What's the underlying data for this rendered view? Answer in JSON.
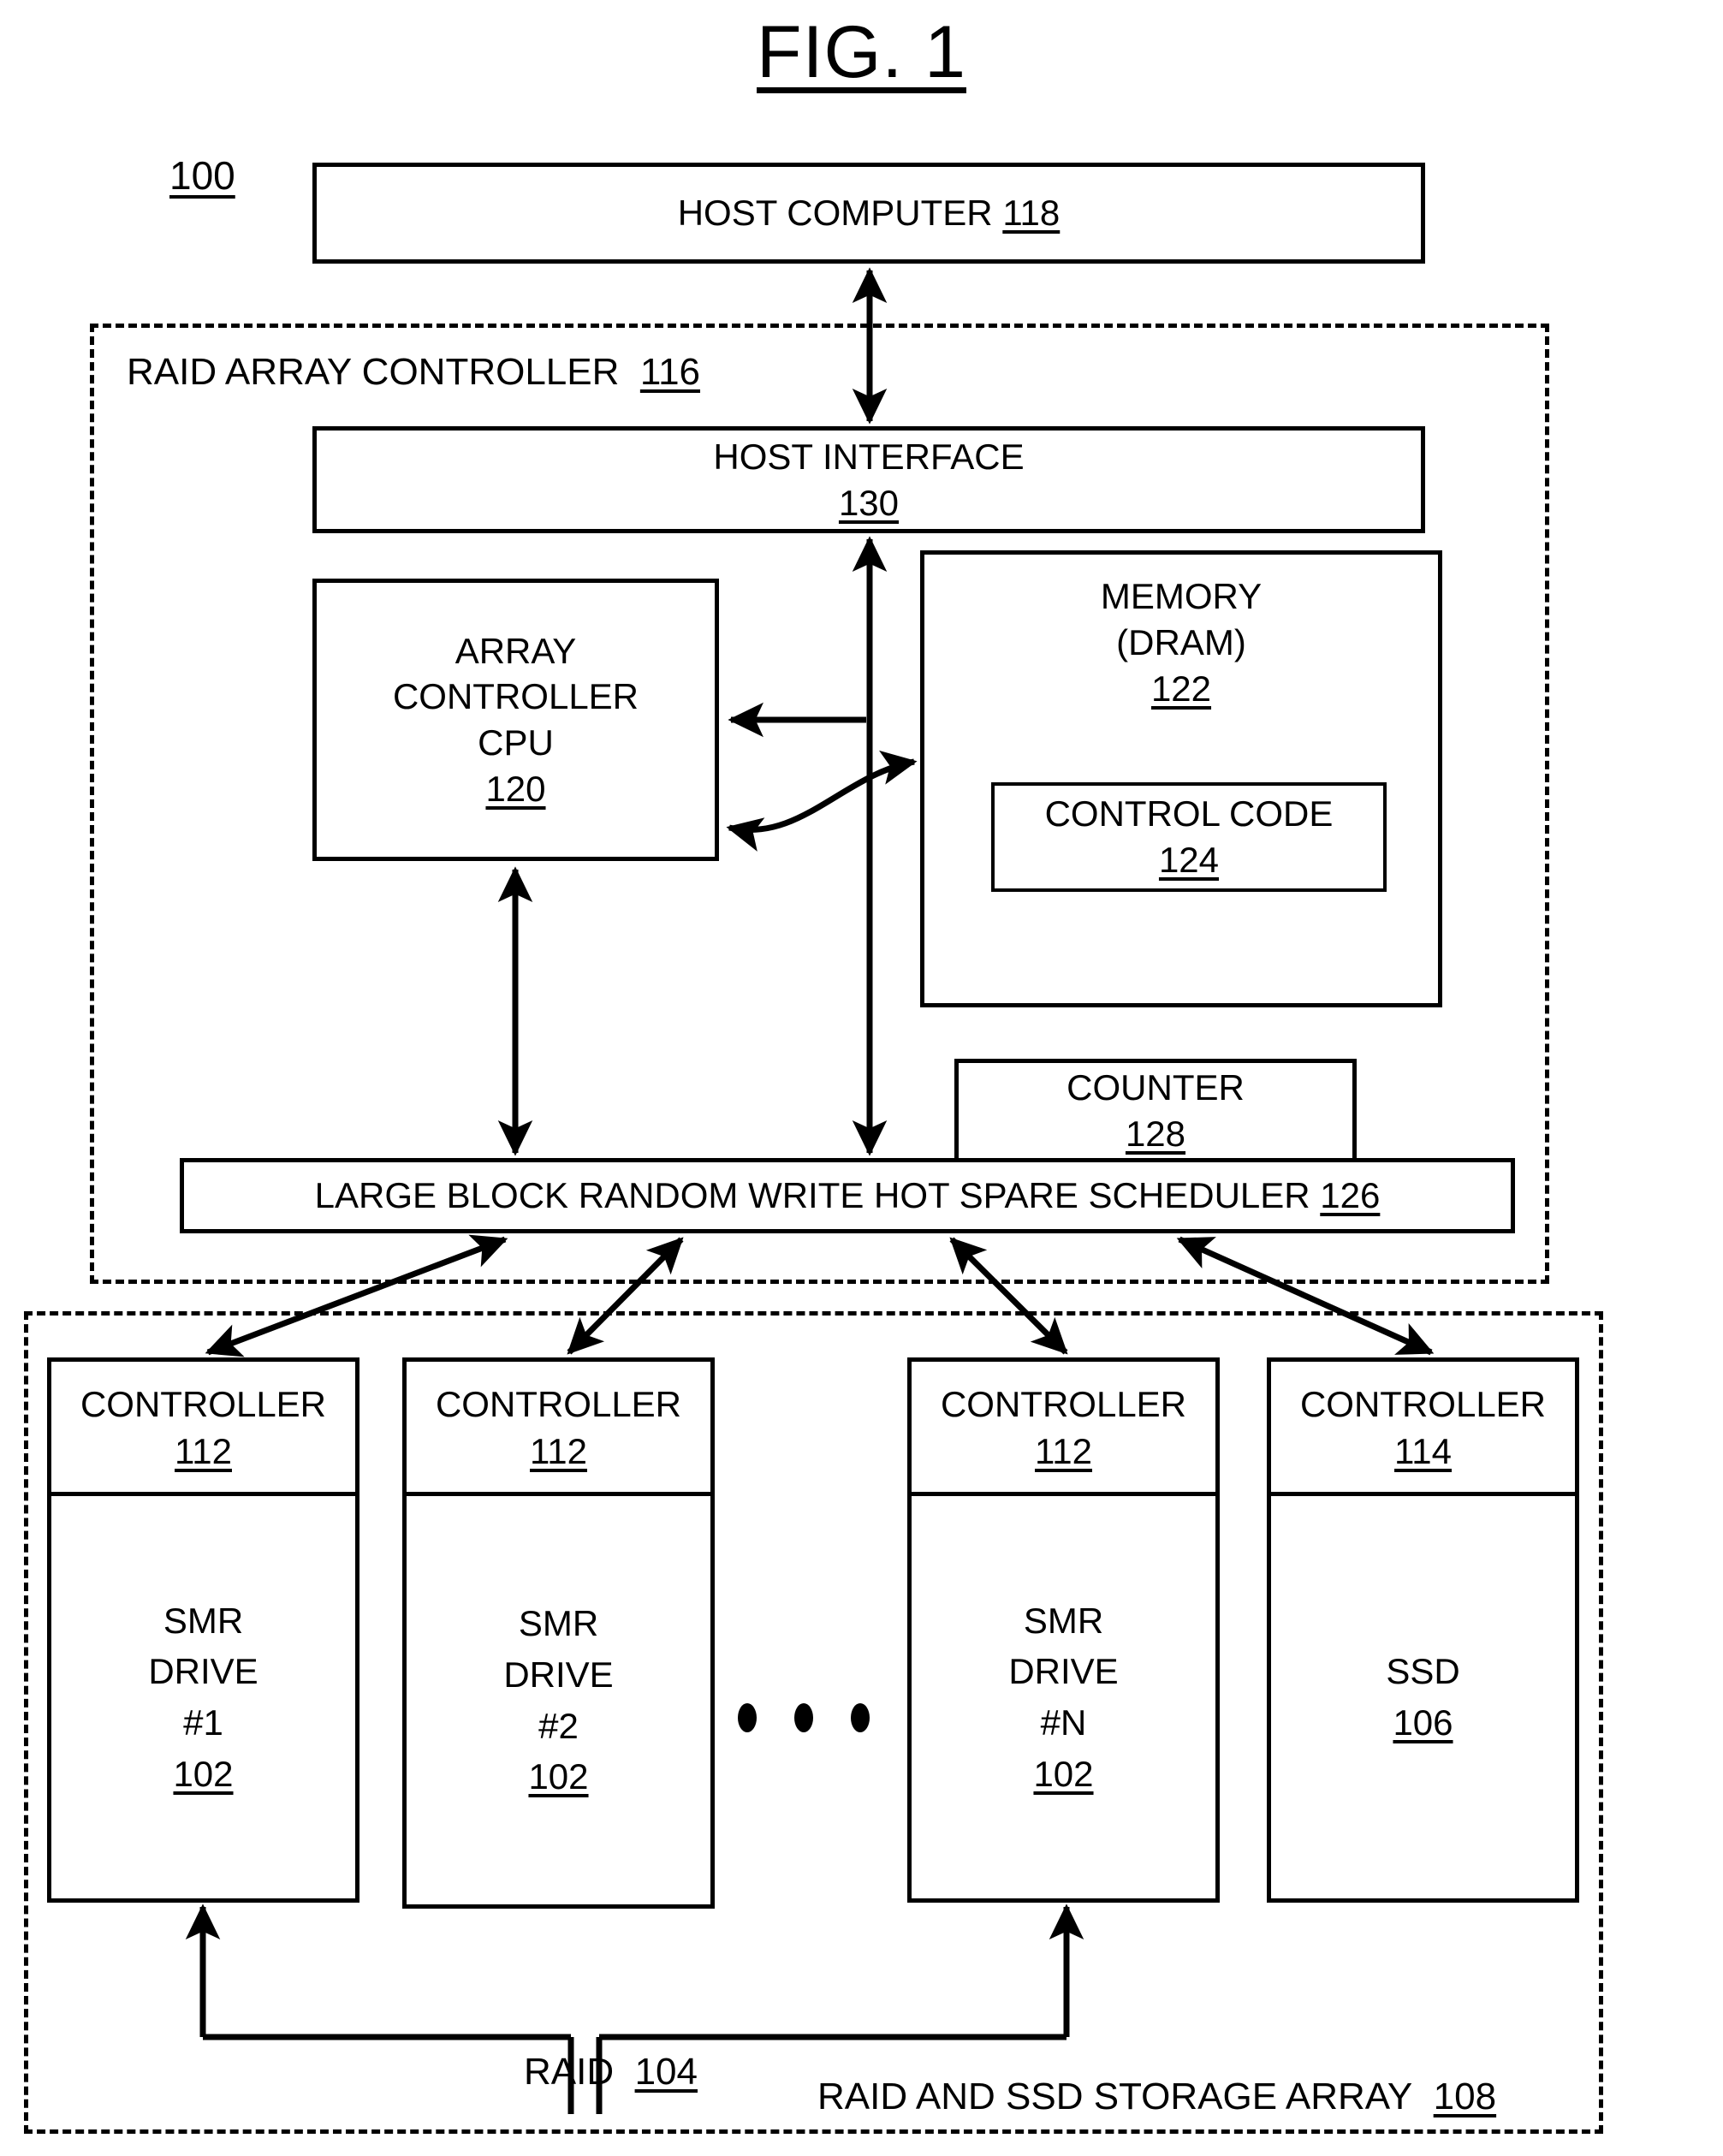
{
  "figure": {
    "title": "FIG. 1",
    "system_ref": "100"
  },
  "host": {
    "label": "HOST COMPUTER",
    "ref": "118"
  },
  "raid_array_controller": {
    "label": "RAID ARRAY CONTROLLER",
    "ref": "116",
    "host_interface": {
      "label": "HOST INTERFACE",
      "ref": "130"
    },
    "cpu": {
      "line1": "ARRAY",
      "line2": "CONTROLLER",
      "line3": "CPU",
      "ref": "120"
    },
    "memory": {
      "line1": "MEMORY",
      "line2": "(DRAM)",
      "ref": "122",
      "control_code": {
        "label": "CONTROL CODE",
        "ref": "124"
      }
    },
    "counter": {
      "label": "COUNTER",
      "ref": "128"
    },
    "scheduler": {
      "label": "LARGE BLOCK RANDOM WRITE HOT SPARE SCHEDULER",
      "ref": "126"
    }
  },
  "storage_array": {
    "label": "RAID AND SSD STORAGE ARRAY",
    "ref": "108",
    "raid_bracket": {
      "label": "RAID",
      "ref": "104"
    },
    "ellipsis": "• • •",
    "drives": [
      {
        "controller_label": "CONTROLLER",
        "controller_ref": "112",
        "body_line1": "SMR",
        "body_line2": "DRIVE",
        "body_line3": "#1",
        "body_ref": "102"
      },
      {
        "controller_label": "CONTROLLER",
        "controller_ref": "112",
        "body_line1": "SMR",
        "body_line2": "DRIVE",
        "body_line3": "#2",
        "body_ref": "102"
      },
      {
        "controller_label": "CONTROLLER",
        "controller_ref": "112",
        "body_line1": "SMR",
        "body_line2": "DRIVE",
        "body_line3": "#N",
        "body_ref": "102"
      },
      {
        "controller_label": "CONTROLLER",
        "controller_ref": "114",
        "body_line1": "SSD",
        "body_line2": "",
        "body_line3": "",
        "body_ref": "106"
      }
    ]
  },
  "colors": {
    "ink": "#000000",
    "paper": "#ffffff"
  }
}
